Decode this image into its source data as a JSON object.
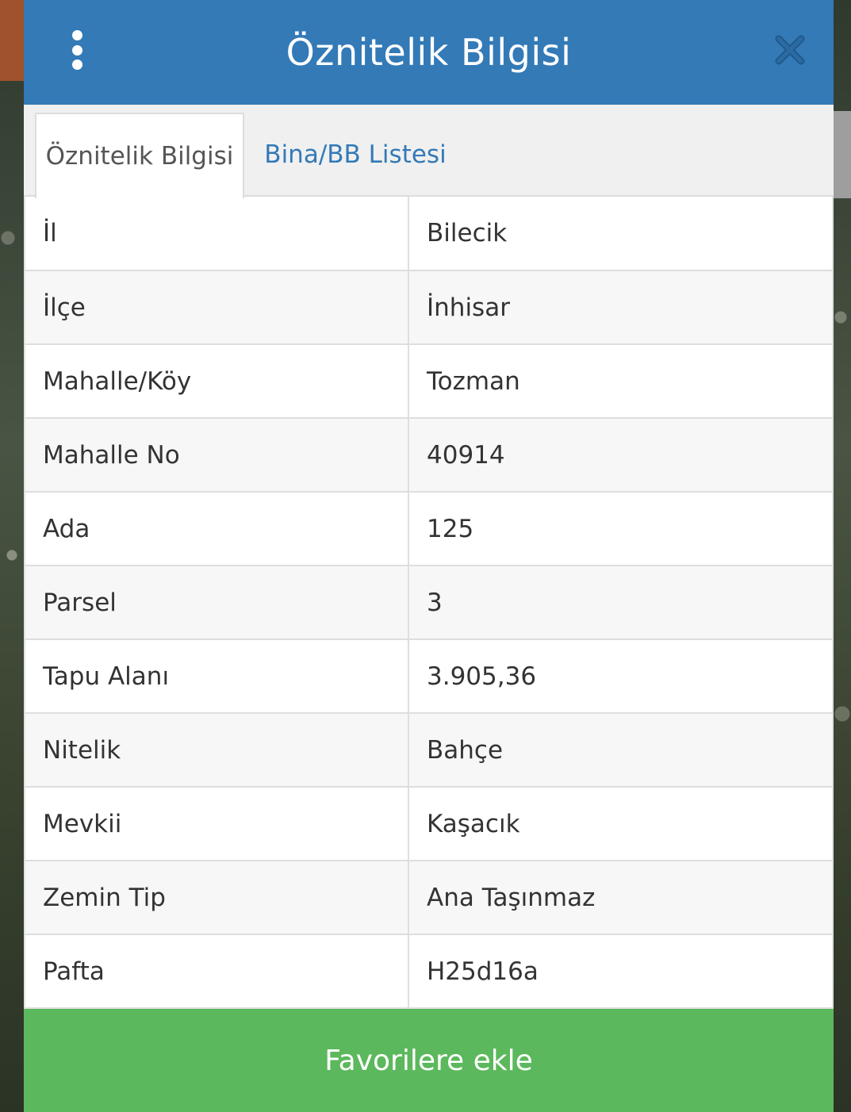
{
  "header": {
    "title": "Öznitelik Bilgisi",
    "menu_icon": "kebab-menu-icon",
    "close_icon": "close-icon"
  },
  "tabs": [
    {
      "label": "Öznitelik Bilgisi",
      "active": true
    },
    {
      "label": "Bina/BB Listesi",
      "active": false
    }
  ],
  "attributes": [
    {
      "key": "İl",
      "value": "Bilecik"
    },
    {
      "key": "İlçe",
      "value": "İnhisar"
    },
    {
      "key": "Mahalle/Köy",
      "value": "Tozman"
    },
    {
      "key": "Mahalle No",
      "value": "40914"
    },
    {
      "key": "Ada",
      "value": "125"
    },
    {
      "key": "Parsel",
      "value": "3"
    },
    {
      "key": "Tapu Alanı",
      "value": "3.905,36"
    },
    {
      "key": "Nitelik",
      "value": "Bahçe"
    },
    {
      "key": "Mevkii",
      "value": "Kaşacık"
    },
    {
      "key": "Zemin Tip",
      "value": "Ana Taşınmaz"
    },
    {
      "key": "Pafta",
      "value": "H25d16a"
    }
  ],
  "footer": {
    "favorite_label": "Favorilere ekle"
  },
  "colors": {
    "header": "#337ab7",
    "tab_link": "#337ab7",
    "favorite_button": "#5cb85c"
  }
}
